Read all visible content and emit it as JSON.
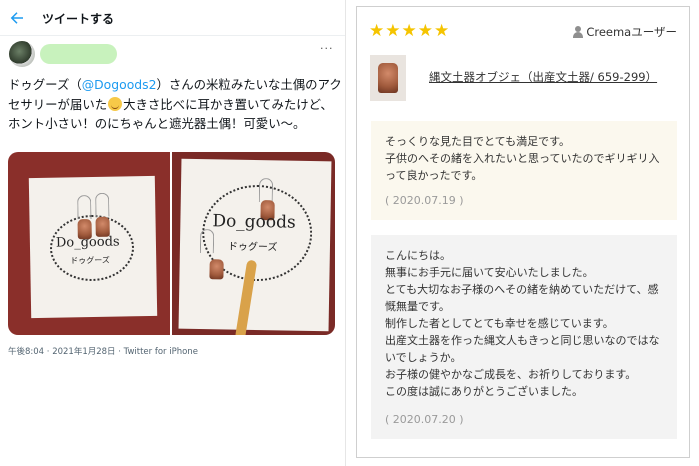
{
  "tweet": {
    "header_title": "ツイートする",
    "more": "···",
    "text_before": "ドゥグーズ（",
    "mention": "@Dogoods2",
    "text_after_mention": "）さんの米粒みたいな土偶のアクセサリーが届いた",
    "text_after_emoji": "大きさ比べに耳かき置いてみたけど、ホント小さい！のにちゃんと遮光器土偶！可愛い〜。",
    "photo_brand": "Do_goods",
    "photo_brand_sub": "ドゥグーズ",
    "meta": "午後8:04 · 2021年1月28日 · Twitter for iPhone"
  },
  "review": {
    "stars": [
      "★",
      "★",
      "★",
      "★",
      "★"
    ],
    "reviewer": "Creemaユーザー",
    "product_title": "縄文土器オブジェ（出産文土器/ 659-299）",
    "buyer_comment": "そっくりな見た目でとても満足です。\n子供のへその緒を入れたいと思っていたのでギリギリ入って良かったです。",
    "buyer_date": "( 2020.07.19 )",
    "seller_reply": "こんにちは。\n無事にお手元に届いて安心いたしました。\nとても大切なお子様のへその緒を納めていただけて、感慨無量です。\n制作した者としてとても幸せを感じています。\n出産文土器を作った縄文人もきっと同じ思いなのではないでしょうか。\nお子様の健やかなご成長を、お祈りしております。\nこの度は誠にありがとうございました。",
    "seller_date": "( 2020.07.20 )"
  },
  "colors": {
    "twitter_blue": "#1d9bf0",
    "star": "#f5c400",
    "buyer_bubble": "#fbf8ee",
    "seller_bubble": "#f3f3f3"
  },
  "icons": [
    "back-arrow-icon",
    "more-icon",
    "star-icon",
    "user-icon",
    "smiling-emoji-icon"
  ]
}
